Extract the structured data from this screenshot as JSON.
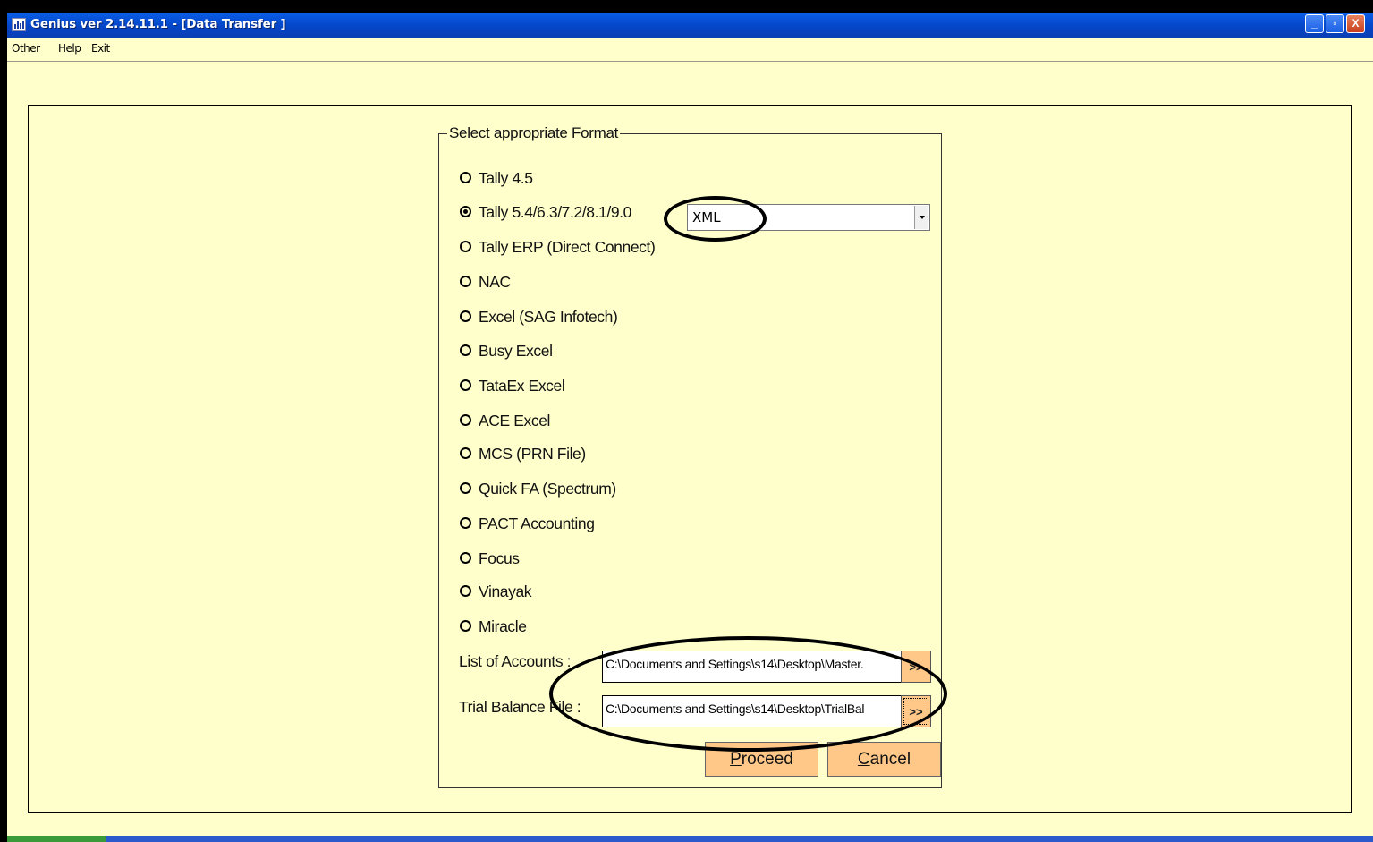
{
  "window": {
    "title": "Genius ver 2.14.11.1 - [Data Transfer ]",
    "controls": [
      "_",
      "▫",
      "X"
    ]
  },
  "menu": [
    "Other",
    "Help",
    "Exit"
  ],
  "group": {
    "legend": "Select appropriate Format",
    "options": [
      {
        "label": "Tally 4.5",
        "selected": false
      },
      {
        "label": "Tally 5.4/6.3/7.2/8.1/9.0",
        "selected": true
      },
      {
        "label": "Tally ERP (Direct Connect)",
        "selected": false
      },
      {
        "label": "NAC",
        "selected": false
      },
      {
        "label": "Excel (SAG Infotech)",
        "selected": false
      },
      {
        "label": "Busy Excel",
        "selected": false
      },
      {
        "label": "TataEx Excel",
        "selected": false
      },
      {
        "label": "ACE Excel",
        "selected": false
      },
      {
        "label": "MCS (PRN File)",
        "selected": false
      },
      {
        "label": "Quick FA (Spectrum)",
        "selected": false
      },
      {
        "label": "PACT Accounting",
        "selected": false
      },
      {
        "label": "Focus",
        "selected": false
      },
      {
        "label": "Vinayak",
        "selected": false
      },
      {
        "label": "Miracle",
        "selected": false
      }
    ],
    "format_combo": {
      "value": "XML"
    }
  },
  "files": {
    "accounts_label": "List of Accounts :",
    "accounts_path": "C:\\Documents and Settings\\s14\\Desktop\\Master.",
    "trial_label": "Trial Balance File :",
    "trial_path": "C:\\Documents and Settings\\s14\\Desktop\\TrialBal",
    "browse_label": ">>"
  },
  "buttons": {
    "proceed_mnemonic": "P",
    "proceed_rest": "roceed",
    "cancel_mnemonic": "C",
    "cancel_rest": "ancel"
  }
}
